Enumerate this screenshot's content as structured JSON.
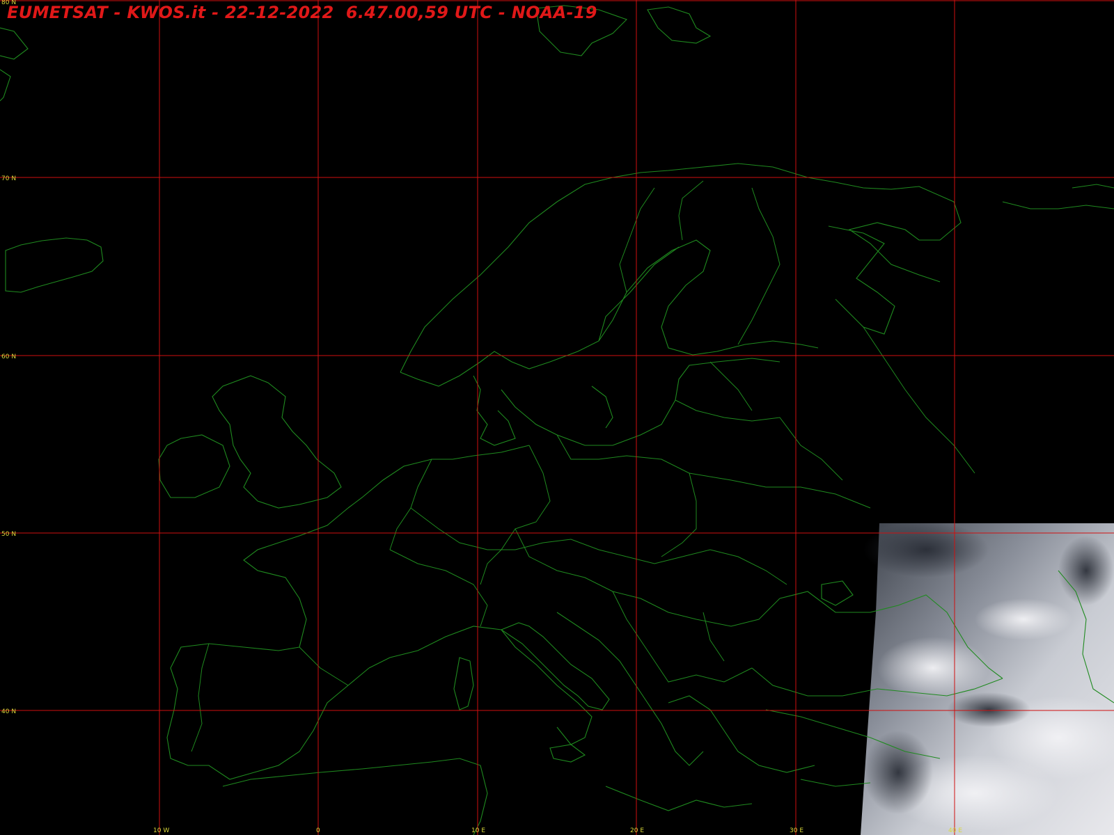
{
  "header": {
    "title": "EUMETSAT - KWOS.it - 22-12-2022  6.47.00,59 UTC - NOAA-19"
  },
  "colors": {
    "background": "#000000",
    "grid": "#d01010",
    "coastline": "#1f8a1f",
    "labels": "#d9d93a",
    "title": "#e01818"
  },
  "grid": {
    "latitudes": [
      {
        "value": 80,
        "label": "80 N"
      },
      {
        "value": 70,
        "label": "70 N"
      },
      {
        "value": 60,
        "label": "60 N"
      },
      {
        "value": 50,
        "label": "50 N"
      },
      {
        "value": 40,
        "label": "40 N"
      }
    ],
    "longitudes": [
      {
        "value": -10,
        "label": "10 W"
      },
      {
        "value": 0,
        "label": "0"
      },
      {
        "value": 10,
        "label": "10 E"
      },
      {
        "value": 20,
        "label": "20 E"
      },
      {
        "value": 30,
        "label": "30 E"
      },
      {
        "value": 40,
        "label": "40 E"
      }
    ]
  }
}
